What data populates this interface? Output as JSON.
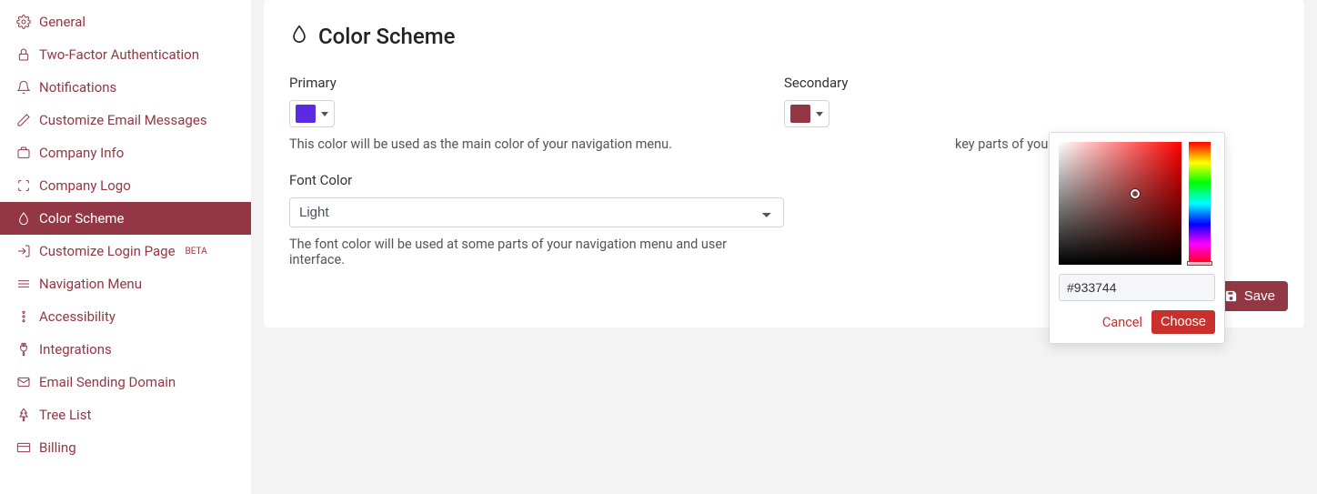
{
  "brand_color": "#933744",
  "sidebar": {
    "items": [
      {
        "label": "General",
        "icon": "gear",
        "active": false
      },
      {
        "label": "Two-Factor Authentication",
        "icon": "lock",
        "active": false
      },
      {
        "label": "Notifications",
        "icon": "bell",
        "active": false
      },
      {
        "label": "Customize Email Messages",
        "icon": "pencil",
        "active": false
      },
      {
        "label": "Company Info",
        "icon": "briefcase",
        "active": false
      },
      {
        "label": "Company Logo",
        "icon": "frame",
        "active": false
      },
      {
        "label": "Color Scheme",
        "icon": "drop",
        "active": true
      },
      {
        "label": "Customize Login Page",
        "icon": "login",
        "badge": "BETA",
        "active": false
      },
      {
        "label": "Navigation Menu",
        "icon": "menu",
        "active": false
      },
      {
        "label": "Accessibility",
        "icon": "dots-vertical",
        "active": false
      },
      {
        "label": "Integrations",
        "icon": "plug",
        "active": false
      },
      {
        "label": "Email Sending Domain",
        "icon": "mail",
        "active": false
      },
      {
        "label": "Tree List",
        "icon": "tree",
        "active": false
      },
      {
        "label": "Billing",
        "icon": "card",
        "active": false
      }
    ]
  },
  "panel": {
    "title": "Color Scheme",
    "primary": {
      "label": "Primary",
      "value": "#5A2BE0",
      "help": "This color will be used as the main color of your navigation menu."
    },
    "secondary": {
      "label": "Secondary",
      "value": "#933744",
      "help_suffix": "key parts of your user interface."
    },
    "font_color": {
      "label": "Font Color",
      "selected": "Light",
      "help": "The font color will be used at some parts of your navigation menu and user interface."
    },
    "save_label": "Save"
  },
  "picker": {
    "hex": "#933744",
    "cancel_label": "Cancel",
    "choose_label": "Choose"
  }
}
